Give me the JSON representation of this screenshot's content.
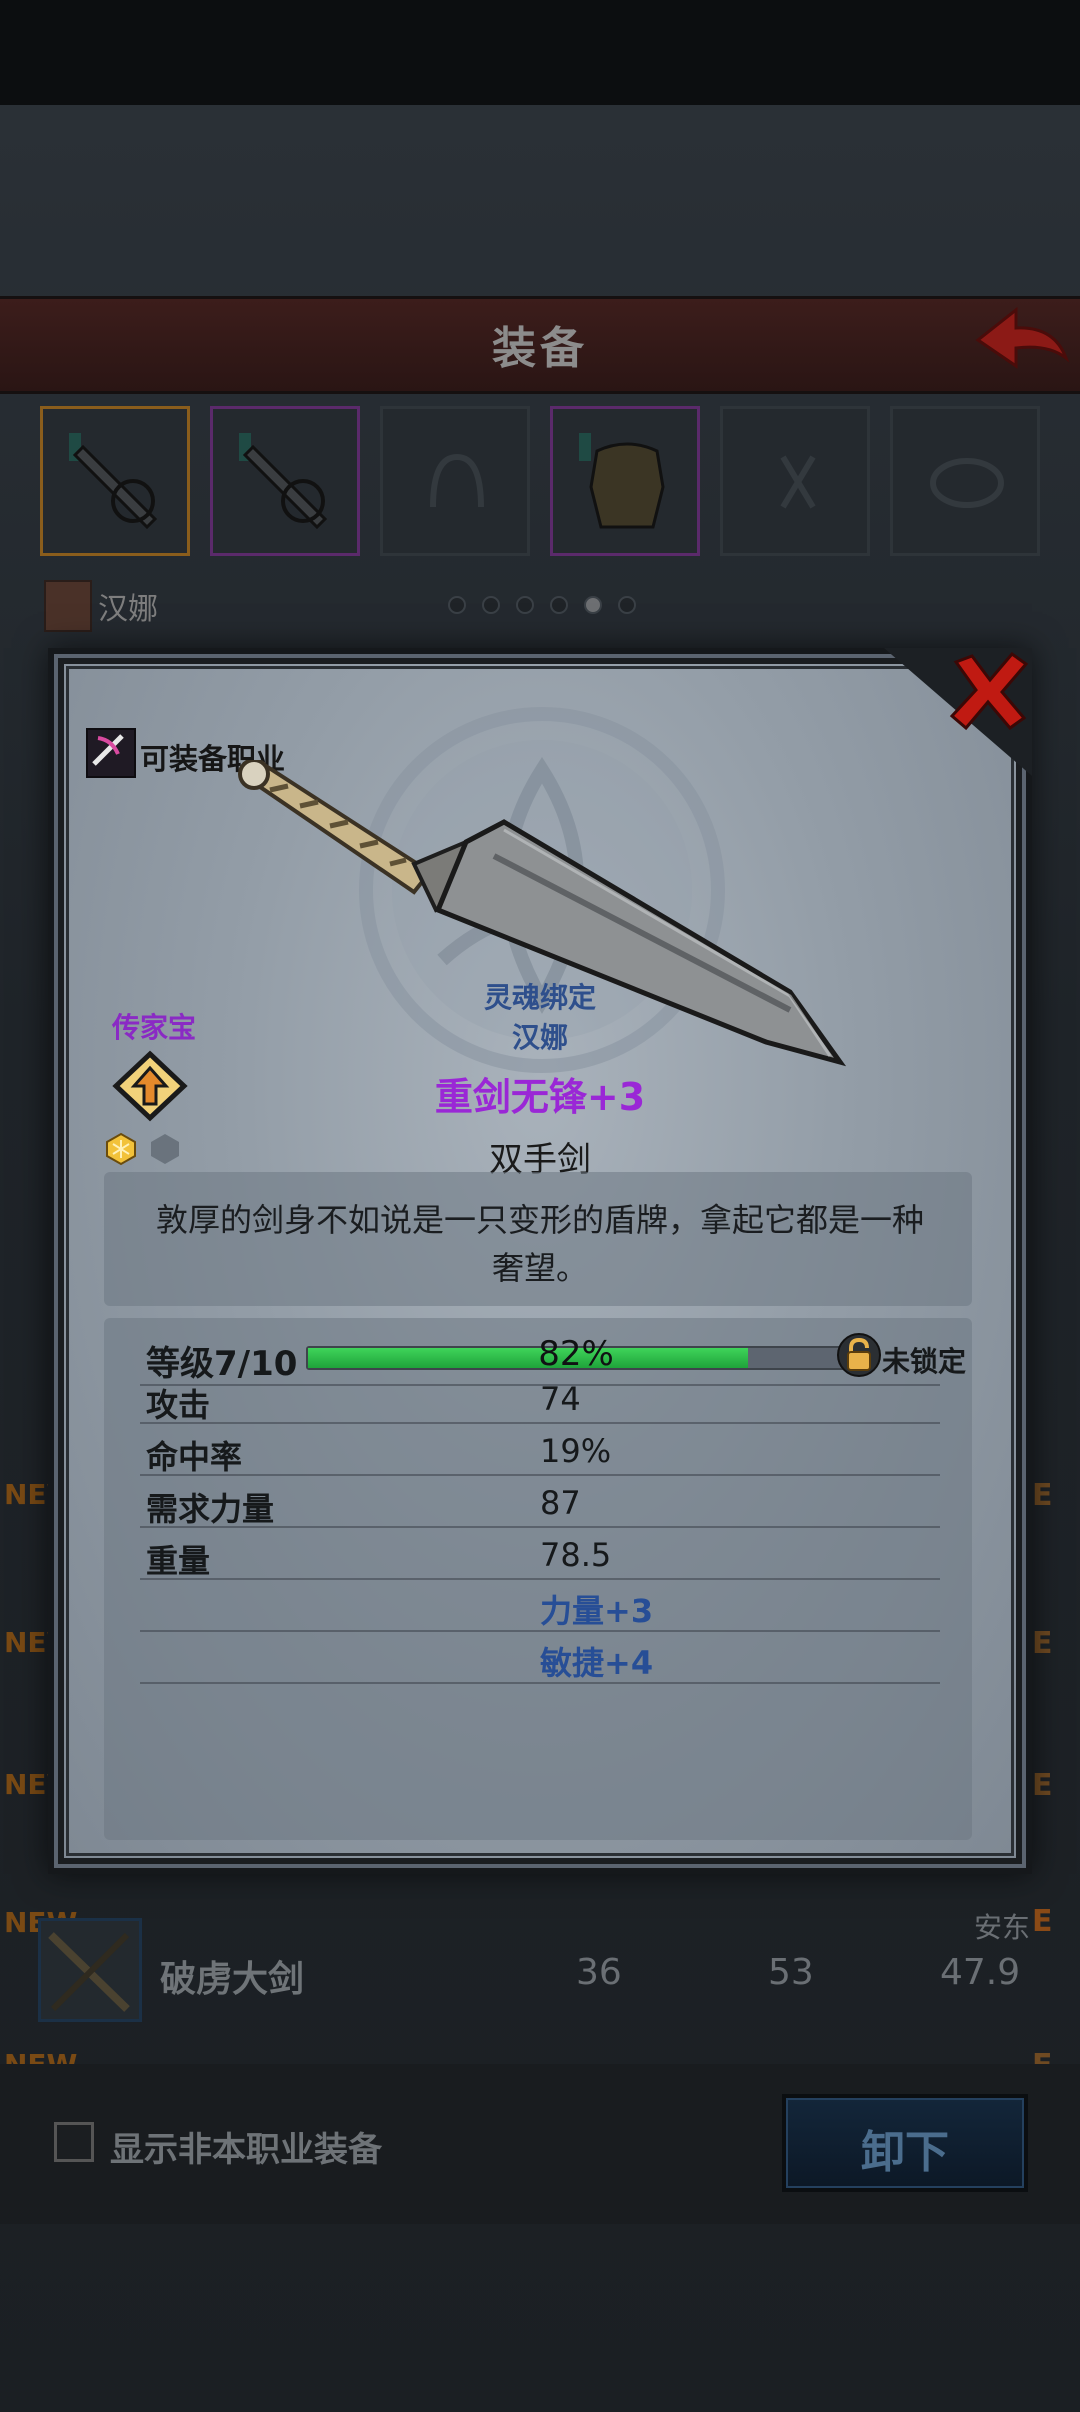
{
  "screen": {
    "title": "装备",
    "character_name": "汉娜",
    "slot_count": 6,
    "page_dots": 6,
    "active_page": 5
  },
  "background_list": {
    "new_tags": [
      "NEW",
      "NEW",
      "NEW",
      "NEW",
      "NEW"
    ],
    "row": {
      "name": "破虏大剑",
      "values": [
        "36",
        "53",
        "47.9"
      ],
      "owner": "安东",
      "grade": "E"
    },
    "side_grades": [
      "E",
      "E",
      "E",
      "E"
    ]
  },
  "bottom_bar": {
    "show_other_class_label": "显示非本职业装备",
    "unequip_label": "卸下"
  },
  "popup": {
    "class_label": "可装备职业",
    "heirloom_label": "传家宝",
    "soulbound_label": "灵魂绑定",
    "soulbound_owner": "汉娜",
    "item_name": "重剑无锋+3",
    "item_type": "双手剑",
    "description": "敦厚的剑身不如说是一只变形的盾牌，拿起它都是一种奢望。",
    "level": {
      "label": "等级7/10",
      "progress_percent": 82,
      "progress_text": "82%",
      "lock_label": "未锁定"
    },
    "stats": [
      {
        "label": "攻击",
        "value": "74"
      },
      {
        "label": "命中率",
        "value": "19%"
      },
      {
        "label": "需求力量",
        "value": "87"
      },
      {
        "label": "重量",
        "value": "78.5"
      }
    ],
    "bonuses": [
      "力量+3",
      "敏捷+4"
    ]
  },
  "colors": {
    "item_name": "#9a27d6",
    "soulbound": "#2e4f8c",
    "level_bar": "#2fbf4a",
    "title_bar": "#3c1d1b"
  }
}
